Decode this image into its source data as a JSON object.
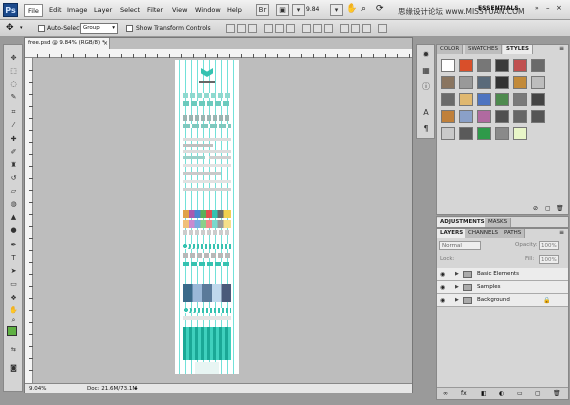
{
  "menubar": {
    "logo": "Ps",
    "items": [
      "File",
      "Edit",
      "Image",
      "Layer",
      "Select",
      "Filter",
      "View",
      "Window",
      "Help"
    ],
    "active_item": "File",
    "zoom": "9.84",
    "workspace": "ESSENTIALS",
    "watermark": "思缘设计论坛 www.MISSYUAN.COM"
  },
  "options": {
    "auto_select_label": "Auto-Select:",
    "auto_select_value": "Group",
    "transform_label": "Show Transform Controls"
  },
  "document": {
    "tab_title": "free.psd @ 9.84% (RGB/8) *",
    "tab_close": "×",
    "status_zoom": "9.04%",
    "status_doc": "Doc: 21.6M/73.1M"
  },
  "colors": {
    "foreground": "#5fb043",
    "background": "#ffffff",
    "canvas_accent": "#35c2b0"
  },
  "styles_panel": {
    "tabs": [
      "COLOR",
      "SWATCHES",
      "STYLES"
    ],
    "active_tab": "STYLES",
    "swatches": [
      "#ffffff",
      "#d94f2a",
      "#777777",
      "#3b3b3b",
      "#c05050",
      "#6a6a6a",
      "#8a7560",
      "#999999",
      "#5a6a7a",
      "#333333",
      "#c28a3a",
      "#bdbdbd",
      "#6a6a6a",
      "#e0b870",
      "#4e74c0",
      "#4e8a4e",
      "#7a7a7a",
      "#444444",
      "#c0803a",
      "#8aa0c8",
      "#b06aa0",
      "#505050",
      "#666666",
      "#555555",
      "#c9c9c9",
      "#5a5a5a",
      "#2f9a4a",
      "#8a8a8a",
      "#e8f5c8"
    ]
  },
  "adjustments_panel": {
    "tabs": [
      "ADJUSTMENTS",
      "MASKS"
    ]
  },
  "layers_panel": {
    "tabs": [
      "LAYERS",
      "CHANNELS",
      "PATHS"
    ],
    "blend_mode": "Normal",
    "opacity_label": "Opacity:",
    "opacity_value": "100%",
    "lock_label": "Lock:",
    "fill_label": "Fill:",
    "fill_value": "100%",
    "layers": [
      {
        "name": "Basic Elements"
      },
      {
        "name": "Samples"
      },
      {
        "name": "Background"
      }
    ]
  },
  "icons": {
    "toolbox": [
      "move-icon",
      "marquee-icon",
      "lasso-icon",
      "quick-select-icon",
      "crop-icon",
      "eyedropper-icon",
      "healing-brush-icon",
      "brush-icon",
      "clone-stamp-icon",
      "history-brush-icon",
      "eraser-icon",
      "paint-bucket-icon",
      "blur-icon",
      "dodge-icon",
      "pen-icon",
      "type-icon",
      "path-select-icon",
      "shape-icon",
      "3d-rotate-icon",
      "hand-icon",
      "zoom-icon"
    ]
  }
}
